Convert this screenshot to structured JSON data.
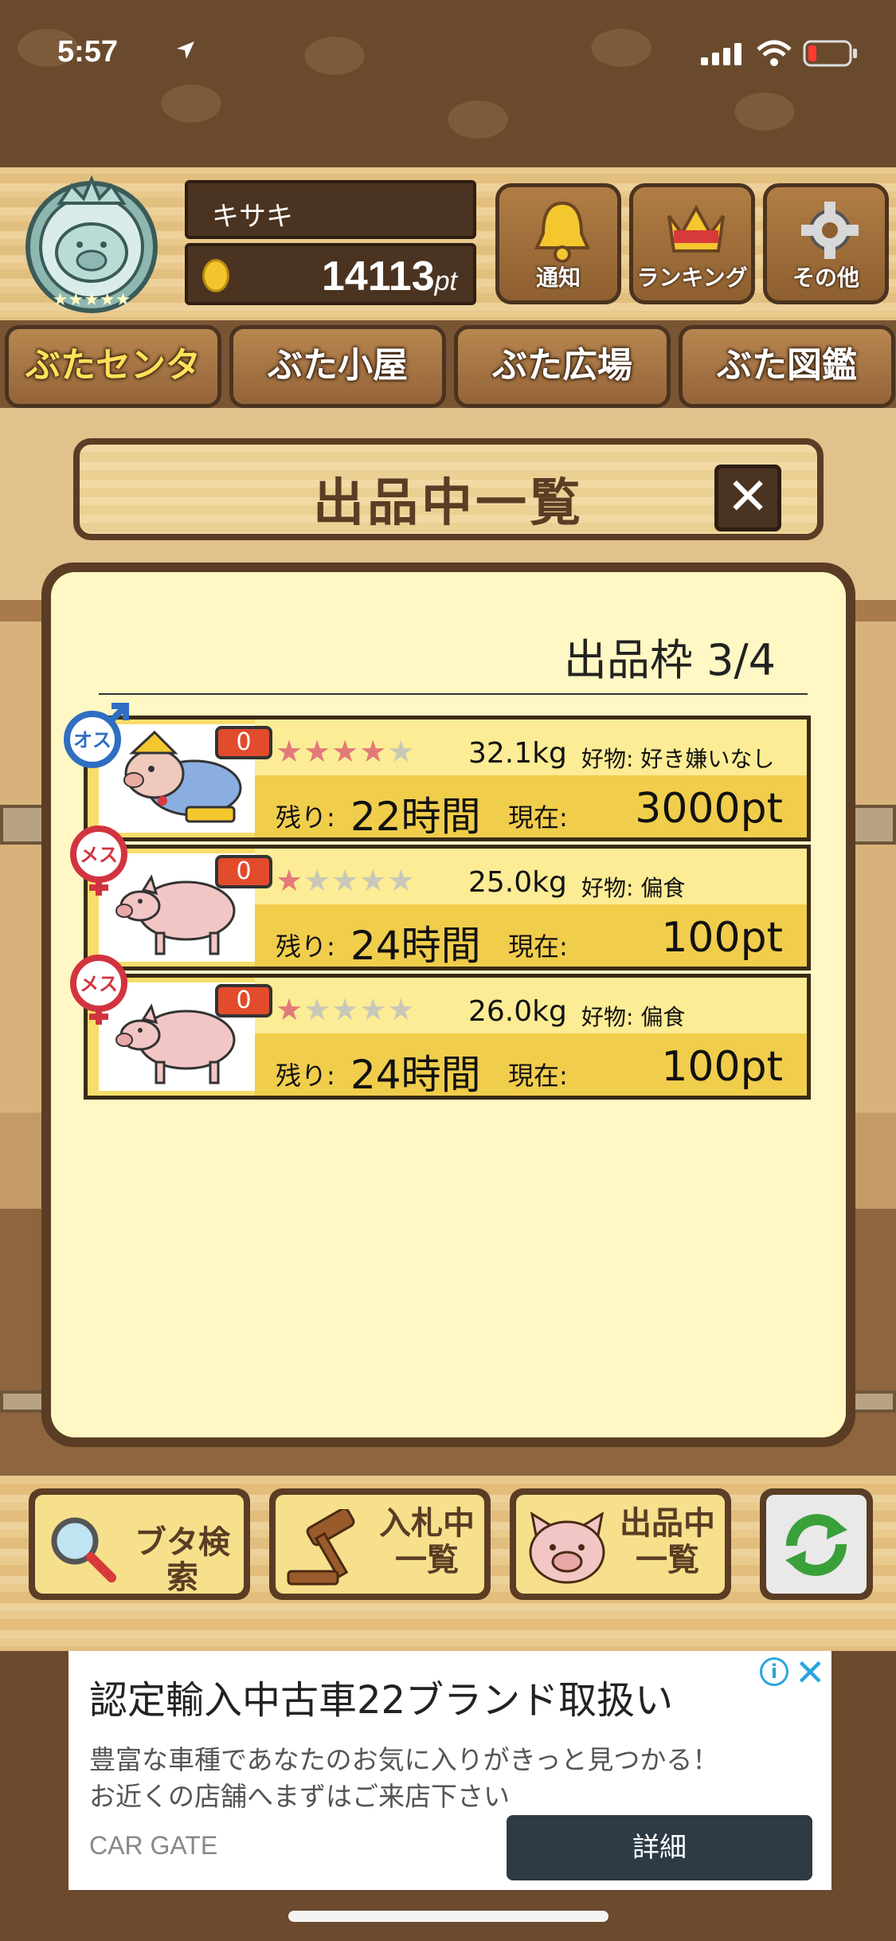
{
  "status_bar": {
    "time": "5:57"
  },
  "header": {
    "user_name": "キサキ",
    "points": "14113",
    "points_unit": "pt",
    "buttons": [
      {
        "label": "通知",
        "icon": "bell-icon"
      },
      {
        "label": "ランキング",
        "icon": "crown-icon"
      },
      {
        "label": "その他",
        "icon": "gear-icon"
      }
    ]
  },
  "nav": {
    "tabs": [
      "ぶたセンター",
      "ぶた小屋",
      "ぶた広場",
      "ぶた図鑑"
    ],
    "active_index": 0
  },
  "dialog": {
    "title": "出品中一覧",
    "close_label": "✕",
    "slot_label": "出品枠 3/4"
  },
  "listings": [
    {
      "gender_icon": "male-icon",
      "gender_label": "オス",
      "badge": "0",
      "stars": 4,
      "stars_max": 5,
      "weight": "32.1kg",
      "favorite": "好物: 好き嫌いなし",
      "remaining_label": "残り:",
      "remaining": "22時間",
      "current_label": "現在:",
      "current": "3000pt"
    },
    {
      "gender_icon": "female-icon",
      "gender_label": "メス",
      "badge": "0",
      "stars": 1,
      "stars_max": 5,
      "weight": "25.0kg",
      "favorite": "好物: 偏食",
      "remaining_label": "残り:",
      "remaining": "24時間",
      "current_label": "現在:",
      "current": "100pt"
    },
    {
      "gender_icon": "female-icon",
      "gender_label": "メス",
      "badge": "0",
      "stars": 1,
      "stars_max": 5,
      "weight": "26.0kg",
      "favorite": "好物: 偏食",
      "remaining_label": "残り:",
      "remaining": "24時間",
      "current_label": "現在:",
      "current": "100pt"
    }
  ],
  "bottom_buttons": {
    "search": "ブタ検索",
    "bidding_line1": "入札中",
    "bidding_line2": "一覧",
    "listing_line1": "出品中",
    "listing_line2": "一覧",
    "refresh_icon": "refresh-icon"
  },
  "ad": {
    "title": "認定輸入中古車22ブランド取扱い",
    "desc_line1": "豊富な車種であなたのお気に入りがきっと見つかる！",
    "desc_line2": "お近くの店舗へまずはご来店下さい",
    "source": "CAR GATE",
    "cta": "詳細",
    "info_label": "i",
    "close_label": "✕"
  },
  "colors": {
    "wood_dark": "#5a3d24",
    "row_top": "#fbec95",
    "row_bottom": "#f1cd4c",
    "active_tab": "#ffe15a",
    "star_on": "#e27a7a",
    "male": "#2f6ec2",
    "female": "#d2343f"
  }
}
